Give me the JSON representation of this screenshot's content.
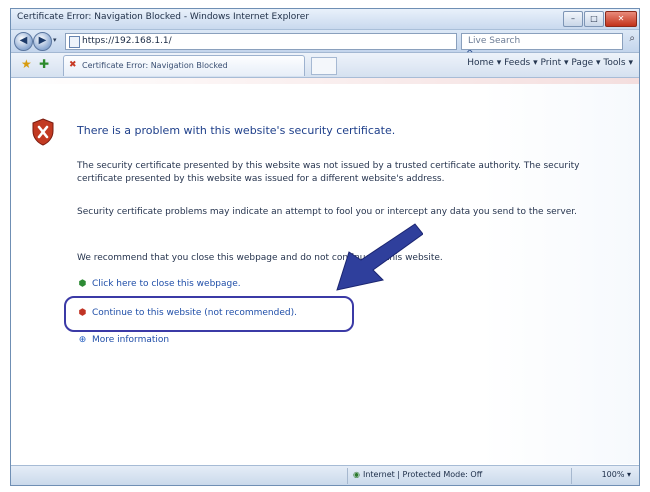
{
  "window": {
    "title": "Certificate Error: Navigation Blocked - Windows Internet Explorer",
    "minimize": "–",
    "maximize": "□",
    "close": "✕"
  },
  "address_bar": {
    "back_icon": "back-arrow-icon",
    "forward_icon": "forward-arrow-icon",
    "url": "https://192.168.1.1/",
    "go_label": "↻ ✕",
    "search_placeholder": "Live Search",
    "search_glyph": "⌕"
  },
  "command_bar": {
    "favorites_glyph": "★",
    "add_favorites_glyph": "✚",
    "tab_label": "Certificate Error: Navigation Blocked",
    "tools_label": "Home ▾  Feeds ▾  Print ▾  Page ▾  Tools ▾"
  },
  "content": {
    "heading": "There is a problem with this website's security certificate.",
    "para1": "The security certificate presented by this website was not issued by a trusted certificate authority. The security certificate presented by this website was issued for a different website's address.",
    "para2": "Security certificate problems may indicate an attempt to fool you or intercept any data you send to the server.",
    "para3": "We recommend that you close this webpage and do not continue to this website.",
    "link_close": "Click here to close this webpage.",
    "link_continue": "Continue to this website (not recommended).",
    "link_more": "More information"
  },
  "status_bar": {
    "zone": "Internet | Protected Mode: Off",
    "zoom": "100%  ▾"
  },
  "colors": {
    "accent_link": "#1f4ea8",
    "heading": "#1e3f8a",
    "highlight": "#3b3aa6",
    "shield": "#c23a22"
  }
}
